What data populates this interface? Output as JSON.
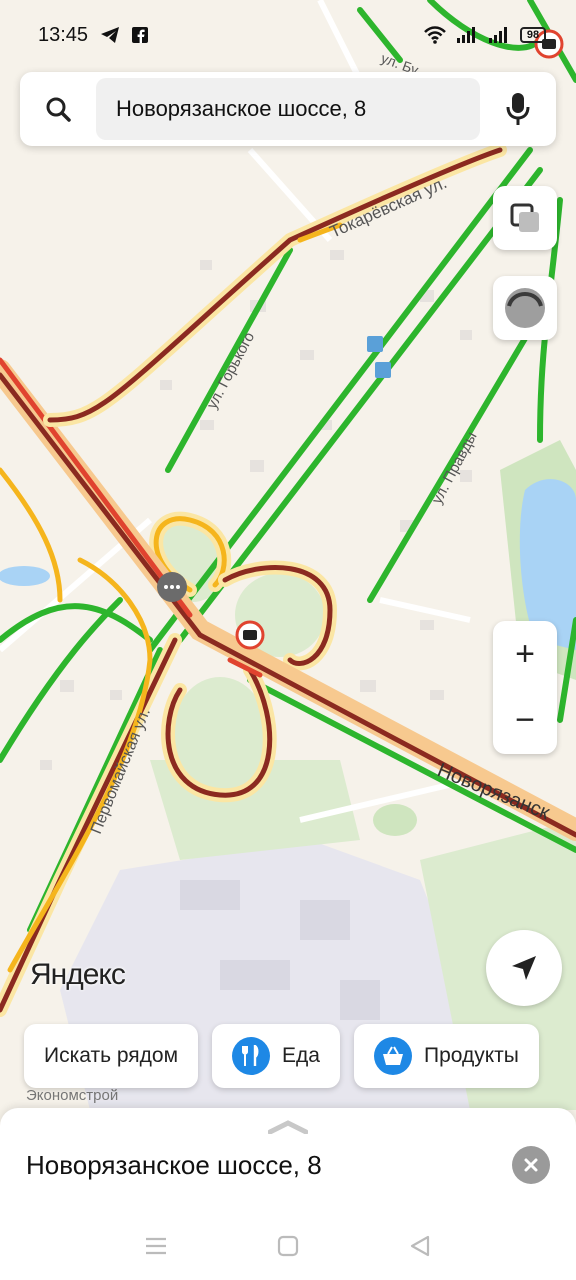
{
  "status_bar": {
    "time": "13:45",
    "battery": "98"
  },
  "search": {
    "query": "Новорязанское шоссе, 8"
  },
  "map": {
    "street_labels": {
      "tokarevskaya": "Токарёвская ул.",
      "gorkogo": "ул. Горького",
      "pravdy": "ул. Правды",
      "pervomayskaya": "Первомайская ул.",
      "novoryazanskoe": "Новорязанск",
      "bu": "ул. Бу",
      "ekonomstroy": "Экономстрой"
    },
    "logo": "Яндекс",
    "zoom_in": "+",
    "zoom_out": "−"
  },
  "chips": [
    {
      "label": "Искать рядом",
      "icon": ""
    },
    {
      "label": "Еда",
      "icon": "fork-knife-icon"
    },
    {
      "label": "Продукты",
      "icon": "basket-icon"
    }
  ],
  "sheet": {
    "title": "Новорязанское шоссе, 8"
  },
  "colors": {
    "traffic_green": "#2db52d",
    "traffic_yellow": "#f5b51d",
    "traffic_red": "#e0432f",
    "traffic_dark_red": "#8b2a20",
    "accent_blue": "#1e88e5"
  }
}
